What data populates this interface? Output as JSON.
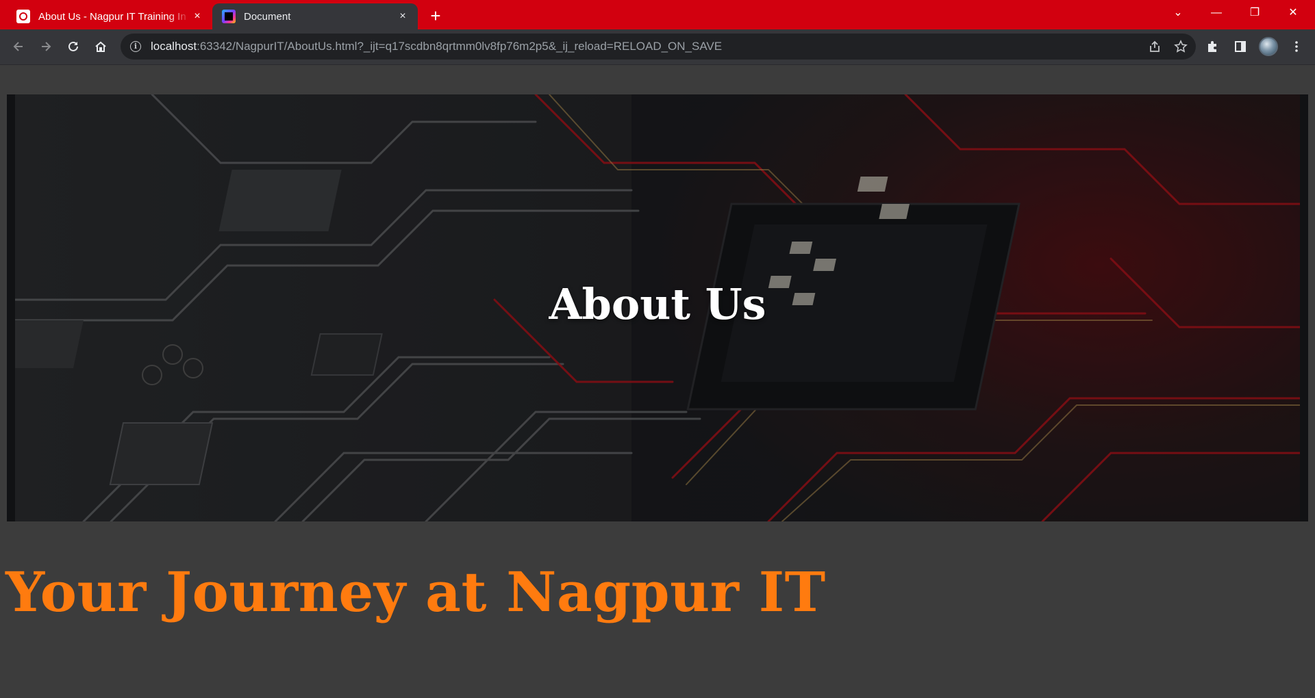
{
  "browser": {
    "tabs": [
      {
        "title": "About Us - Nagpur IT Training In",
        "close": "×",
        "active": false
      },
      {
        "title": "Document",
        "close": "×",
        "active": true
      }
    ],
    "new_tab": "+",
    "window_controls": {
      "dropdown": "⌄",
      "minimize": "—",
      "restore": "❐",
      "close": "✕"
    },
    "url": {
      "host": "localhost",
      "rest": ":63342/NagpurIT/AboutUs.html?_ijt=q17scdbn8qrtmm0lv8fp76m2p5&_ij_reload=RELOAD_ON_SAVE"
    },
    "icons": {
      "back": "arrow-left-icon",
      "forward": "arrow-right-icon",
      "reload": "reload-icon",
      "home": "home-icon",
      "info": "info-icon",
      "share": "share-icon",
      "bookmark": "star-icon",
      "extensions": "puzzle-icon",
      "sidepanel": "side-panel-icon",
      "menu": "kebab-menu-icon"
    },
    "colors": {
      "tab_strip": "#d2000f",
      "toolbar": "#35363a",
      "omnibox": "#202124"
    }
  },
  "page": {
    "hero_title": "About Us",
    "heading": "Your Journey at Nagpur IT",
    "colors": {
      "background": "#3c3c3c",
      "heading": "#ff7b0f",
      "hero_title": "#ffffff"
    }
  }
}
